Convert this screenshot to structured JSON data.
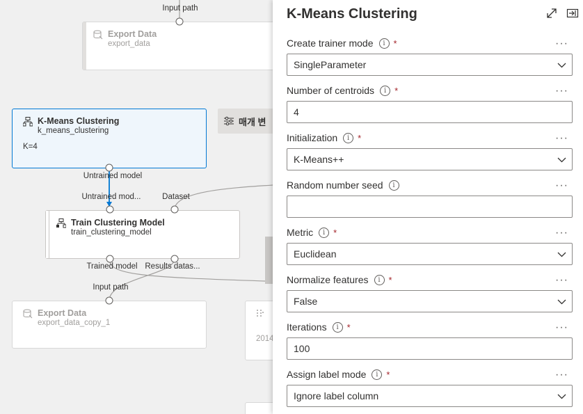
{
  "canvas": {
    "nodes": {
      "export_top": {
        "title": "Export Data",
        "subtitle": "export_data"
      },
      "kmeans": {
        "title": "K-Means Clustering",
        "subtitle": "k_means_clustering",
        "param": "K=4"
      },
      "train": {
        "title": "Train Clustering Model",
        "subtitle": "train_clustering_model"
      },
      "export_bottom": {
        "title": "Export Data",
        "subtitle": "export_data_copy_1"
      },
      "partial_right": {
        "subtitle": "2014"
      }
    },
    "ports": {
      "input_path_top": "Input path",
      "untrained_model_out": "Untrained model",
      "untrained_model_in": "Untrained mod...",
      "dataset_in": "Dataset",
      "trained_model_out": "Trained model",
      "results_dataset_out": "Results datas...",
      "input_path_bottom": "Input path"
    },
    "chip_label": "매개 변"
  },
  "panel": {
    "title": "K-Means Clustering",
    "fields": [
      {
        "label": "Create trainer mode",
        "required": "*",
        "value": "SingleParameter",
        "type": "dropdown"
      },
      {
        "label": "Number of centroids",
        "required": "*",
        "value": "4",
        "type": "text"
      },
      {
        "label": "Initialization",
        "required": "*",
        "value": "K-Means++",
        "type": "dropdown"
      },
      {
        "label": "Random number seed",
        "required": "",
        "value": "",
        "type": "text"
      },
      {
        "label": "Metric",
        "required": "*",
        "value": "Euclidean",
        "type": "dropdown"
      },
      {
        "label": "Normalize features",
        "required": "*",
        "value": "False",
        "type": "dropdown"
      },
      {
        "label": "Iterations",
        "required": "*",
        "value": "100",
        "type": "text"
      },
      {
        "label": "Assign label mode",
        "required": "*",
        "value": "Ignore label column",
        "type": "dropdown"
      }
    ],
    "info_glyph": "i",
    "more_glyph": "···"
  },
  "colors": {
    "accent": "#0078d4",
    "required": "#a4262c",
    "selected_bg": "#eff6fc"
  }
}
